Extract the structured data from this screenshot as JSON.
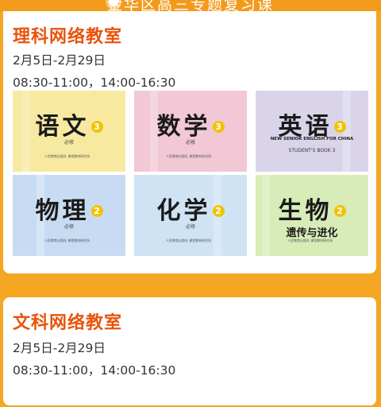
{
  "header": {
    "title": "金华区高三专题复习课"
  },
  "sections": [
    {
      "title": "理科网络教室",
      "date": "2月5日-2月29日",
      "time": "08:30-11:00，14:00-16:30",
      "books": [
        {
          "subject": "语文",
          "grade": "3",
          "bg": "#f7e9a0",
          "publisher": "人民教育出版社 课程教材研究所",
          "tag": "必修"
        },
        {
          "subject": "数学",
          "grade": "3",
          "bg": "#f2c7d6",
          "publisher": "人民教育出版社 课程教材研究所",
          "tag": "必修"
        },
        {
          "subject": "英语",
          "grade": "3",
          "bg": "#d9d4ea",
          "publisher": "人民教育出版社 课程教材研究所",
          "tag": "必修",
          "english": "NEW SENIOR ENGLISH FOR CHINA",
          "english2": "STUDENT'S BOOK 3"
        },
        {
          "subject": "物理",
          "grade": "2",
          "bg": "#c7dcf2",
          "publisher": "人民教育出版社 课程教材研究所",
          "tag": "必修"
        },
        {
          "subject": "化学",
          "grade": "2",
          "bg": "#cfe3f4",
          "publisher": "人民教育出版社 课程教材研究所",
          "tag": "必修"
        },
        {
          "subject": "生物",
          "grade": "2",
          "bg": "#d8ecb8",
          "publisher": "人民教育出版社 课程教材研究所",
          "tag": "必修",
          "subtitle": "遗传与进化"
        }
      ]
    },
    {
      "title": "文科网络教室",
      "date": "2月5日-2月29日",
      "time": "08:30-11:00，14:00-16:30"
    }
  ],
  "colors": {
    "accent": "#f5a623",
    "title": "#e8540d"
  },
  "icons": {
    "logo": "school-logo-icon"
  }
}
